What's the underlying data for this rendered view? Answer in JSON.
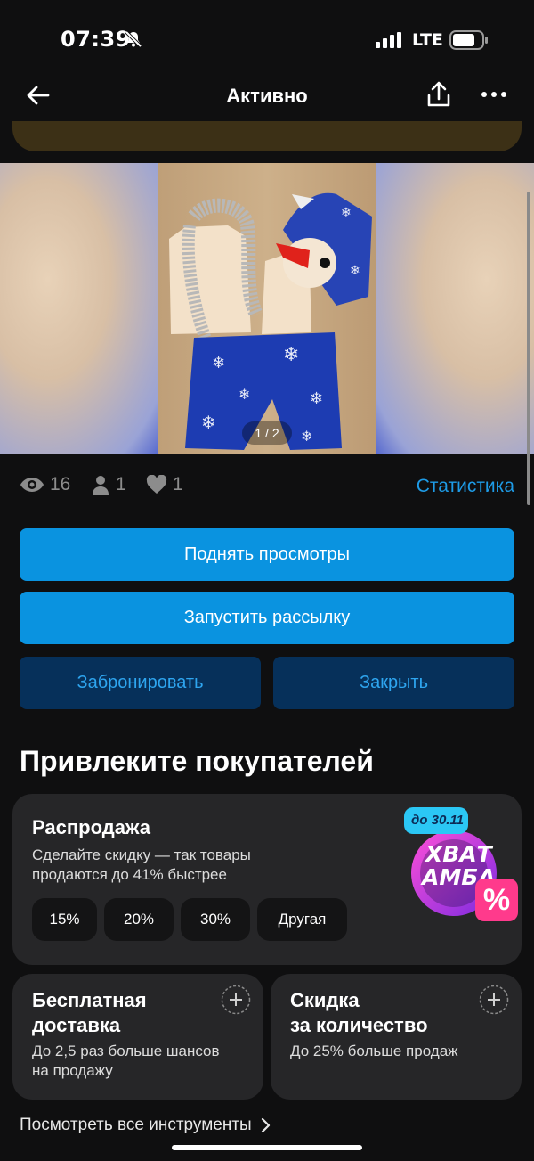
{
  "status_bar": {
    "time": "07:39",
    "network": "LTE"
  },
  "nav": {
    "title": "Активно"
  },
  "gallery": {
    "counter": "1 / 2"
  },
  "stats": {
    "views": "16",
    "contacts": "1",
    "favorites": "1",
    "link": "Статистика"
  },
  "actions": {
    "raise_views": "Поднять просмотры",
    "mailing": "Запустить рассылку",
    "reserve": "Забронировать",
    "close": "Закрыть"
  },
  "promote": {
    "title": "Привлеките покупателей",
    "sale": {
      "title": "Распродажа",
      "desc_line1": "Сделайте скидку — так товары",
      "desc_line2": "продаются до 41% быстрее",
      "chips": [
        "15%",
        "20%",
        "30%",
        "Другая"
      ],
      "badge_date": "до 30.11",
      "badge_line1": "ХВАТ",
      "badge_line2": "АМБА",
      "badge_percent": "%"
    },
    "free_delivery": {
      "title_line1": "Бесплатная",
      "title_line2": "доставка",
      "desc_line1": "До 2,5 раз больше шансов",
      "desc_line2": "на продажу"
    },
    "quantity_discount": {
      "title_line1": "Скидка",
      "title_line2": "за количество",
      "desc_line1": "До 25% больше продаж"
    },
    "all_tools": "Посмотреть все инструменты"
  },
  "colors": {
    "accent": "#0a93e0",
    "secondary_bg": "#06305a",
    "link": "#1e9be6",
    "card": "#262628"
  }
}
